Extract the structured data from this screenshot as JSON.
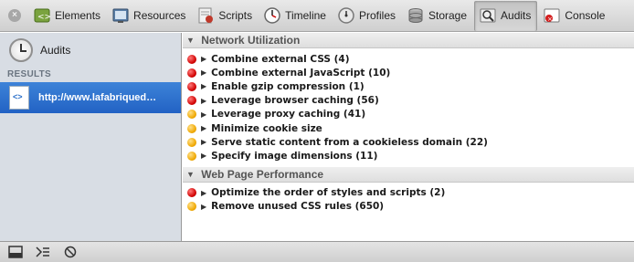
{
  "toolbar": {
    "tabs": [
      {
        "label": "Elements",
        "icon": "elements-icon"
      },
      {
        "label": "Resources",
        "icon": "resources-icon"
      },
      {
        "label": "Scripts",
        "icon": "scripts-icon"
      },
      {
        "label": "Timeline",
        "icon": "timeline-icon"
      },
      {
        "label": "Profiles",
        "icon": "profiles-icon"
      },
      {
        "label": "Storage",
        "icon": "storage-icon"
      },
      {
        "label": "Audits",
        "icon": "audits-icon"
      },
      {
        "label": "Console",
        "icon": "console-icon"
      }
    ],
    "selected_tab": "Audits"
  },
  "sidebar": {
    "audits_label": "Audits",
    "results_header": "RESULTS",
    "result_item": "http://www.lafabriqued…"
  },
  "sections": [
    {
      "title": "Network Utilization",
      "rules": [
        {
          "severity": "red",
          "text": "Combine external CSS (4)"
        },
        {
          "severity": "red",
          "text": "Combine external JavaScript (10)"
        },
        {
          "severity": "red",
          "text": "Enable gzip compression (1)"
        },
        {
          "severity": "red",
          "text": "Leverage browser caching (56)"
        },
        {
          "severity": "orange",
          "text": "Leverage proxy caching (41)"
        },
        {
          "severity": "orange",
          "text": "Minimize cookie size"
        },
        {
          "severity": "orange",
          "text": "Serve static content from a cookieless domain (22)"
        },
        {
          "severity": "orange",
          "text": "Specify image dimensions (11)"
        }
      ]
    },
    {
      "title": "Web Page Performance",
      "rules": [
        {
          "severity": "red",
          "text": "Optimize the order of styles and scripts (2)"
        },
        {
          "severity": "orange",
          "text": "Remove unused CSS rules (650)"
        }
      ]
    }
  ],
  "colors": {
    "selection_blue": "#2a6fd0",
    "sidebar_bg": "#d8dde4",
    "severity_red": "#d10000",
    "severity_orange": "#f0a800"
  }
}
